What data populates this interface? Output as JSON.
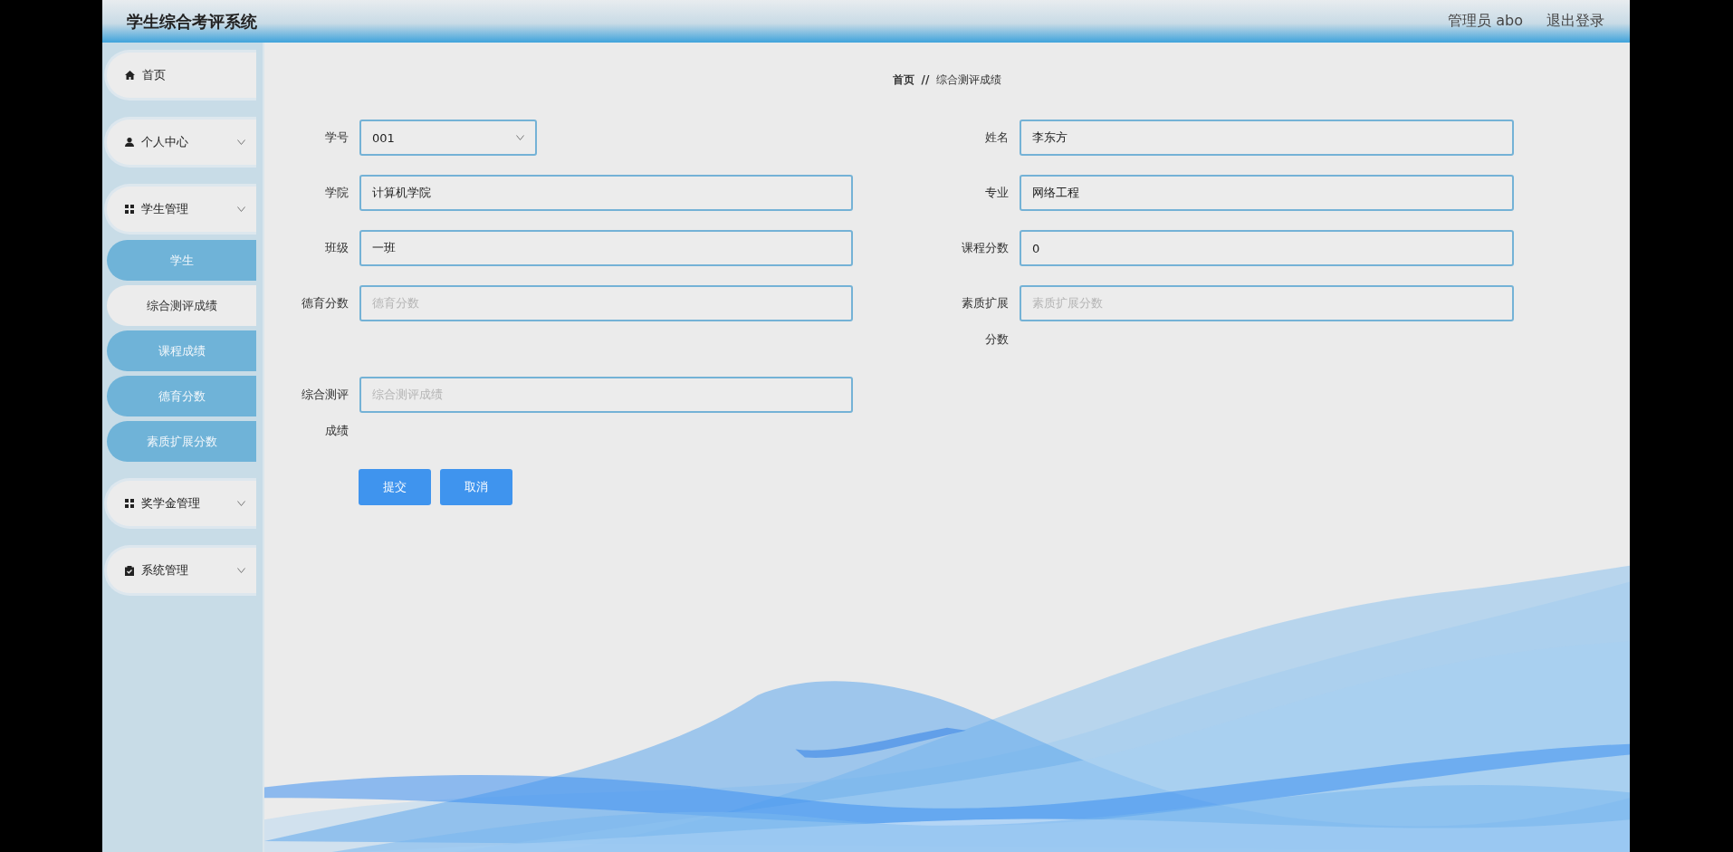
{
  "header": {
    "title": "学生综合考评系统",
    "user": "管理员 abo",
    "logout": "退出登录"
  },
  "sidebar": {
    "items": [
      {
        "label": "首页",
        "kind": "link",
        "selected": false
      },
      {
        "label": "个人中心",
        "kind": "submenu",
        "selected": false
      },
      {
        "label": "学生管理",
        "kind": "submenu",
        "selected": false,
        "children": [
          {
            "label": "学生",
            "selected": false
          },
          {
            "label": "综合测评成绩",
            "selected": true
          },
          {
            "label": "课程成绩",
            "selected": false
          },
          {
            "label": "德育分数",
            "selected": false
          },
          {
            "label": "素质扩展分数",
            "selected": false
          }
        ]
      },
      {
        "label": "奖学金管理",
        "kind": "submenu",
        "selected": false
      },
      {
        "label": "系统管理",
        "kind": "submenu",
        "selected": false
      }
    ]
  },
  "breadcrumb": {
    "home": "首页",
    "separator": "//",
    "current": "综合测评成绩"
  },
  "form": {
    "fields": [
      {
        "label": "学号",
        "kind": "select",
        "value": "001"
      },
      {
        "label": "姓名",
        "kind": "text",
        "value": "李东方"
      },
      {
        "label": "学院",
        "kind": "text",
        "value": "计算机学院"
      },
      {
        "label": "专业",
        "kind": "text",
        "value": "网络工程"
      },
      {
        "label": "班级",
        "kind": "text",
        "value": "一班"
      },
      {
        "label": "课程分数",
        "kind": "text",
        "value": "0"
      },
      {
        "label": "德育分数",
        "kind": "text",
        "placeholder": "德育分数"
      },
      {
        "label": "素质扩展分数",
        "kind": "text",
        "placeholder": "素质扩展分数"
      },
      {
        "label": "综合测评成绩",
        "kind": "text",
        "placeholder": "综合测评成绩"
      }
    ],
    "buttons": [
      "提交",
      "取消"
    ]
  }
}
